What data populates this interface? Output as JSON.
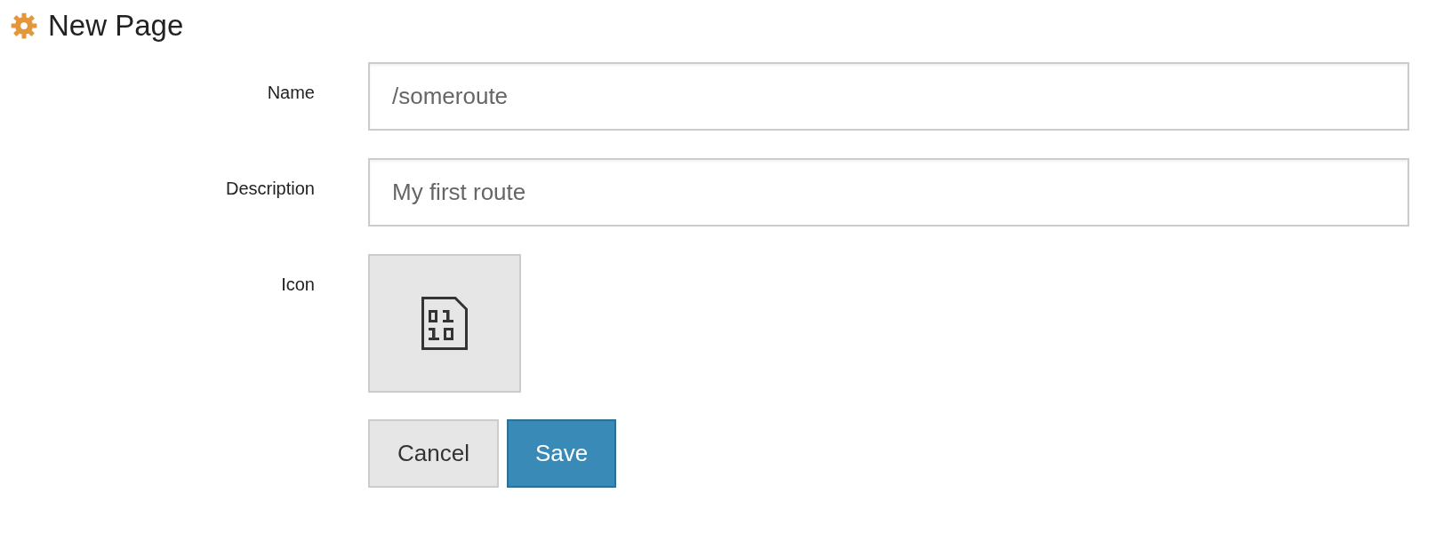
{
  "header": {
    "title": "New Page"
  },
  "form": {
    "fields": [
      {
        "kind": "text",
        "label": "Name",
        "value": "/someroute"
      },
      {
        "kind": "text",
        "label": "Description",
        "value": "My first route"
      },
      {
        "kind": "icon",
        "label": "Icon"
      }
    ]
  },
  "buttons": [
    {
      "kind": "secondary",
      "label": "Cancel"
    },
    {
      "kind": "primary",
      "label": "Save"
    }
  ]
}
